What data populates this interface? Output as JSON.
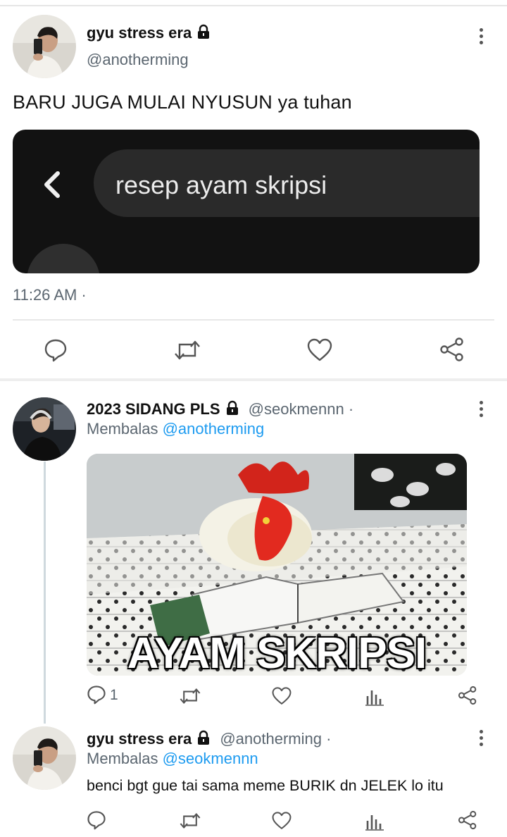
{
  "tweet1": {
    "name": "gyu stress era",
    "handle": "@anotherming",
    "text": "BARU JUGA MULAI NYUSUN ya tuhan",
    "embedded_search": {
      "query": "resep ayam skripsi"
    },
    "time": "11:26 AM ·"
  },
  "reply1": {
    "name": "2023 SIDANG PLS",
    "handle": "@seokmennn ·",
    "replying_prefix": "Membalas ",
    "replying_to": "@anotherming",
    "image_caption": "AYAM SKRIPSI",
    "reply_count": "1"
  },
  "reply2": {
    "name": "gyu stress era",
    "handle": "@anotherming ·",
    "replying_prefix": "Membalas ",
    "replying_to": "@seokmennn",
    "text": "benci bgt gue tai sama meme BURIK dn JELEK lo itu"
  },
  "icons": {
    "reply": "speech-bubble-icon",
    "retweet": "retweet-icon",
    "like": "heart-icon",
    "share": "share-icon",
    "analytics": "bar-chart-icon",
    "more": "vertical-dots-icon",
    "lock": "padlock-icon"
  },
  "colors": {
    "link": "#1d9bf0",
    "muted": "#5b6670",
    "text": "#0f1419"
  }
}
